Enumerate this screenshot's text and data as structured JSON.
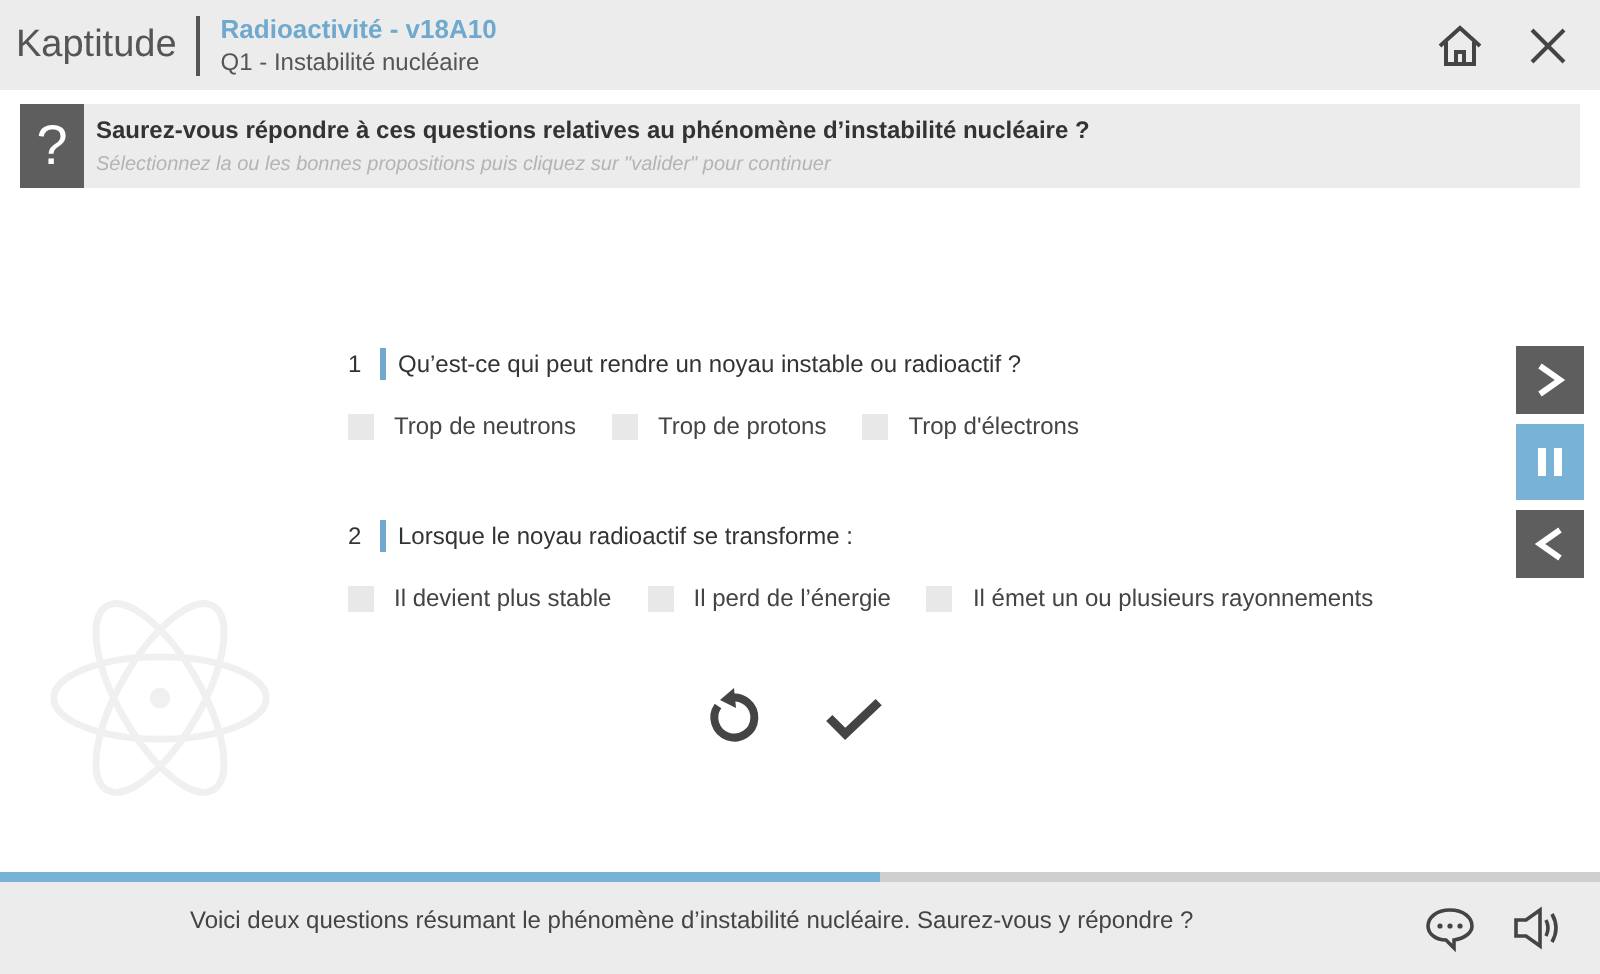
{
  "header": {
    "logo": "Kaptitude",
    "title": "Radioactivité - v18A10",
    "subtitle": "Q1 - Instabilité nucléaire"
  },
  "instruction": {
    "icon": "?",
    "question": "Saurez-vous répondre à ces questions relatives au phénomène d’instabilité nucléaire ?",
    "hint": "Sélectionnez la ou les bonnes propositions puis cliquez sur \"valider\" pour continuer"
  },
  "questions": [
    {
      "number": "1",
      "text": "Qu’est-ce qui peut rendre un noyau instable ou radioactif ?",
      "options": [
        {
          "label": "Trop de neutrons",
          "checked": false
        },
        {
          "label": "Trop de protons",
          "checked": false
        },
        {
          "label": "Trop d'électrons",
          "checked": false
        }
      ]
    },
    {
      "number": "2",
      "text": "Lorsque le noyau radioactif se transforme :",
      "options": [
        {
          "label": "Il devient plus stable",
          "checked": false
        },
        {
          "label": "Il perd de l’énergie",
          "checked": false
        },
        {
          "label": "Il émet un ou plusieurs rayonnements",
          "checked": false
        }
      ]
    }
  ],
  "side_nav": [
    {
      "kind": "next",
      "selected": false
    },
    {
      "kind": "pause",
      "selected": true
    },
    {
      "kind": "previous",
      "selected": false
    }
  ],
  "progress": {
    "level": 0.55
  },
  "footer": {
    "caption": "Voici deux questions résumant le phénomène d’instabilité nucléaire. Saurez-vous y répondre ?"
  }
}
